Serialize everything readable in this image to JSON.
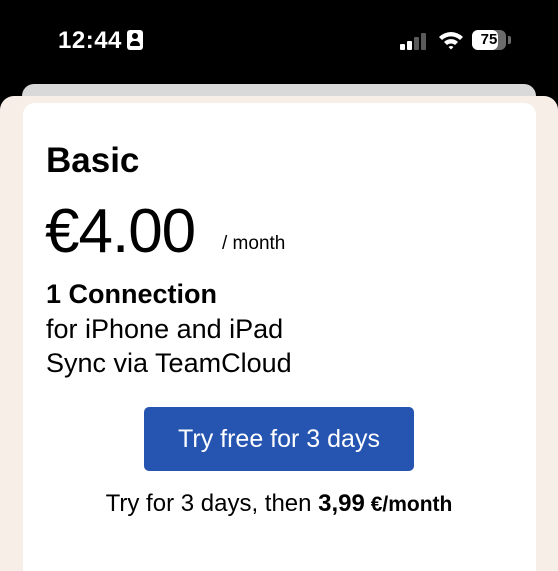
{
  "status_bar": {
    "time": "12:44",
    "battery_percent": "75",
    "icons": [
      "contact-card-icon",
      "signal-icon",
      "wifi-icon",
      "battery-icon"
    ],
    "signal_bars_active": 2,
    "signal_bars_total": 4
  },
  "plan": {
    "name": "Basic",
    "price": "€4.00",
    "period": "/ month",
    "feature_main": "1 Connection",
    "features": [
      "for iPhone and iPad",
      "Sync via TeamCloud"
    ]
  },
  "cta": {
    "button_label": "Try free for 3 days",
    "note_prefix": "Try for 3 days, then ",
    "note_amount": "3,99",
    "note_unit": " €/month"
  },
  "colors": {
    "accent": "#2655b1",
    "sheet_background": "#f7efe7",
    "card_background": "#ffffff"
  }
}
